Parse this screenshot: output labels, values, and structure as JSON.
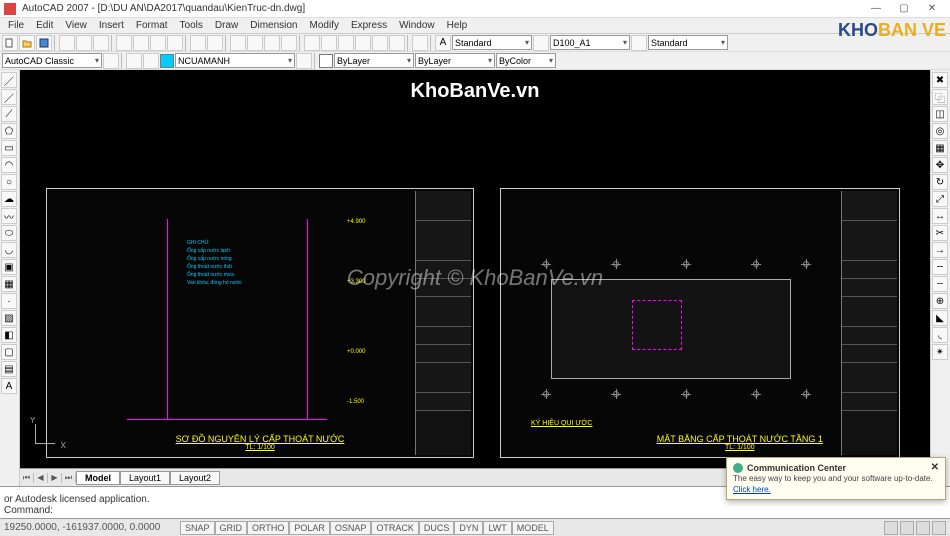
{
  "window": {
    "title": "AutoCAD 2007 - [D:\\DU AN\\DA2017\\quandau\\KienTruc-dn.dwg]",
    "min": "—",
    "max": "▢",
    "close": "✕"
  },
  "menus": [
    "File",
    "Edit",
    "View",
    "Insert",
    "Format",
    "Tools",
    "Draw",
    "Dimension",
    "Modify",
    "Express",
    "Window",
    "Help"
  ],
  "combos": {
    "workspace": "AutoCAD Classic",
    "layer": "NCUAMANH",
    "textstyle1": "Standard",
    "dimstyle": "D100_A1",
    "tablestyle": "Standard",
    "linetype": "ByLayer",
    "lineweight": "ByLayer",
    "color": "ByColor"
  },
  "tabs": {
    "model": "Model",
    "layout1": "Layout1",
    "layout2": "Layout2"
  },
  "cmd": {
    "history": "or Autodesk licensed application.",
    "prompt": "Command:"
  },
  "status": {
    "coords": "19250.0000, -161937.0000, 0.0000",
    "toggles": [
      "SNAP",
      "GRID",
      "ORTHO",
      "POLAR",
      "OSNAP",
      "OTRACK",
      "DUCS",
      "DYN",
      "LWT",
      "MODEL"
    ]
  },
  "watermarks": {
    "top": "KhoBanVe.vn",
    "mid": "Copyright © KhoBanVe.vn",
    "logo_a": "KHO",
    "logo_b": "BAN VE"
  },
  "sheet1": {
    "title": "SƠ ĐỒ NGUYÊN LÝ CẤP THOÁT NƯỚC",
    "scale": "TL: 1/100",
    "levels": [
      "+4.900",
      "+3.300",
      "+0.000",
      "-1.500"
    ],
    "notes": [
      "GHI CHÚ:",
      "Ống cấp nước lạnh",
      "Ống cấp nước nóng",
      "Ống thoát nước thải",
      "Ống thoát nước mưa",
      "Van khóa, đồng hồ nước"
    ]
  },
  "sheet2": {
    "title": "MẶT BẰNG CẤP THOÁT NƯỚC TẦNG 1",
    "scale": "TL: 1/100",
    "legend_title": "KÝ HIỆU QUI ƯỚC"
  },
  "comm": {
    "title": "Communication Center",
    "body": "The easy way to keep you and your software up-to-date.",
    "link": "Click here."
  }
}
